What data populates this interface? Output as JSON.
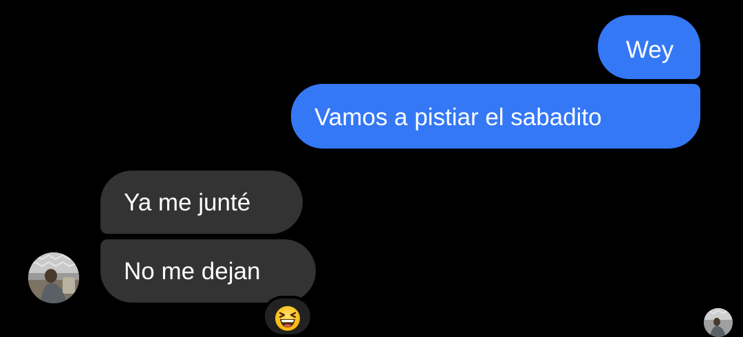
{
  "conversation": {
    "messages": [
      {
        "sender": "me",
        "text": "Wey"
      },
      {
        "sender": "me",
        "text": "Vamos a pistiar el sabadito"
      },
      {
        "sender": "contact",
        "text": "Ya me junté"
      },
      {
        "sender": "contact",
        "text": "No me dejan",
        "reaction": "grinning-squinting-face-emoji"
      }
    ]
  },
  "colors": {
    "background": "#000000",
    "outgoing_bubble": "#3478f6",
    "incoming_bubble": "#333333",
    "text": "#ffffff"
  },
  "icons": {
    "contact_avatar": "contact-avatar-photo",
    "read_receipt": "read-receipt-avatar",
    "reaction": "grinning-squinting-face-emoji"
  }
}
